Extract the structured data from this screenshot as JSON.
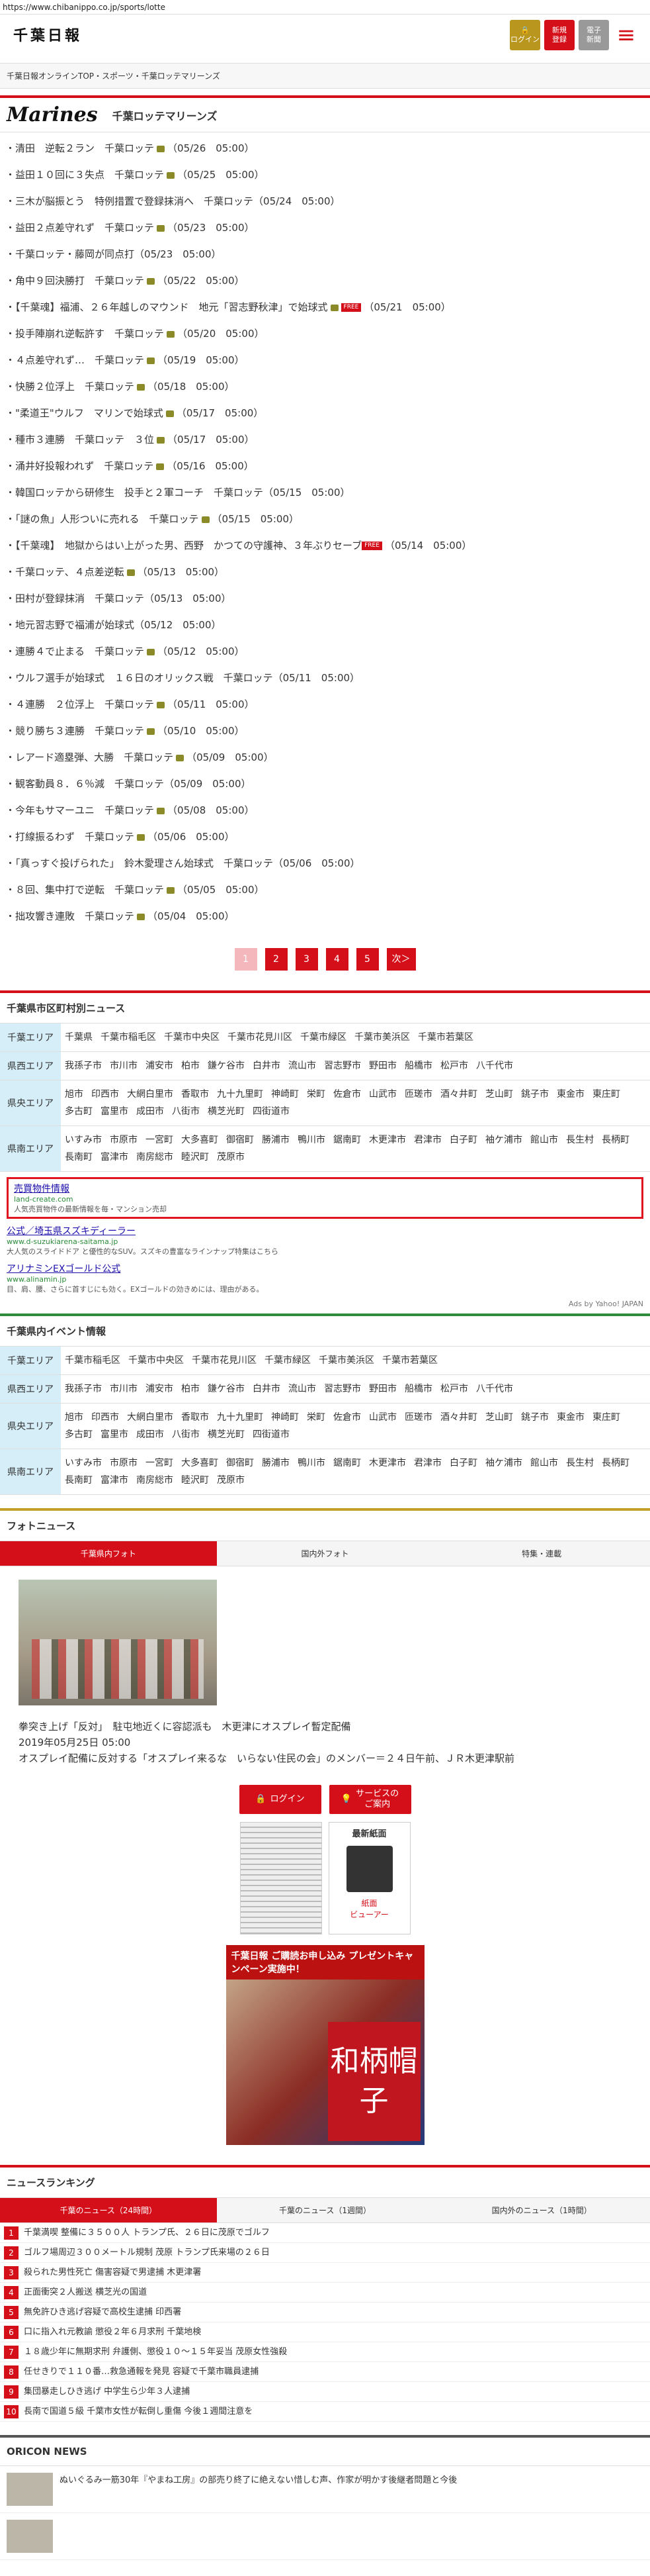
{
  "url": "https://www.chibanippo.co.jp/sports/lotte",
  "header": {
    "logo": "千葉日報",
    "login": "ログイン",
    "register": "新規\n登録",
    "paper": "電子\n新聞",
    "menu": "≡"
  },
  "breadcrumb": "千葉日報オンラインTOP・スポーツ・千葉ロッテマリーンズ",
  "team": {
    "logo": "Marines",
    "title": "千葉ロッテマリーンズ"
  },
  "news": [
    {
      "t": "清田　逆転２ラン　千葉ロッテ",
      "d": "（05/26　05:00）",
      "cam": true
    },
    {
      "t": "益田１０回に３失点　千葉ロッテ",
      "d": "（05/25　05:00）",
      "cam": true
    },
    {
      "t": "三木が脳振とう　特例措置で登録抹消へ　千葉ロッテ",
      "d": "（05/24　05:00）",
      "cam": false
    },
    {
      "t": "益田２点差守れず　千葉ロッテ",
      "d": "（05/23　05:00）",
      "cam": true
    },
    {
      "t": "千葉ロッテ・藤岡が同点打",
      "d": "（05/23　05:00）",
      "cam": false
    },
    {
      "t": "角中９回決勝打　千葉ロッテ",
      "d": "（05/22　05:00）",
      "cam": true
    },
    {
      "t": "【千葉魂】福浦、２６年越しのマウンド　地元「習志野秋津」で始球式",
      "d": "（05/21　05:00）",
      "cam": true,
      "free": true
    },
    {
      "t": "投手陣崩れ逆転許す　千葉ロッテ",
      "d": "（05/20　05:00）",
      "cam": true
    },
    {
      "t": "４点差守れず…　千葉ロッテ",
      "d": "（05/19　05:00）",
      "cam": true
    },
    {
      "t": "快勝２位浮上　千葉ロッテ",
      "d": "（05/18　05:00）",
      "cam": true
    },
    {
      "t": "\"柔道王\"ウルフ　マリンで始球式",
      "d": "（05/17　05:00）",
      "cam": true
    },
    {
      "t": "種市３連勝　千葉ロッテ　３位",
      "d": "（05/17　05:00）",
      "cam": true
    },
    {
      "t": "涌井好投報われず　千葉ロッテ",
      "d": "（05/16　05:00）",
      "cam": true
    },
    {
      "t": "韓国ロッテから研修生　投手と２軍コーチ　千葉ロッテ",
      "d": "（05/15　05:00）",
      "cam": false
    },
    {
      "t": "「謎の魚」人形ついに売れる　千葉ロッテ",
      "d": "（05/15　05:00）",
      "cam": true
    },
    {
      "t": "【千葉魂】　地獄からはい上がった男、西野　かつての守護神、３年ぶりセーブ",
      "d": "（05/14　05:00）",
      "cam": false,
      "free": true
    },
    {
      "t": "千葉ロッテ、４点差逆転",
      "d": "（05/13　05:00）",
      "cam": true
    },
    {
      "t": "田村が登録抹消　千葉ロッテ",
      "d": "（05/13　05:00）",
      "cam": false
    },
    {
      "t": "地元習志野で福浦が始球式",
      "d": "（05/12　05:00）",
      "cam": false
    },
    {
      "t": "連勝４で止まる　千葉ロッテ",
      "d": "（05/12　05:00）",
      "cam": true
    },
    {
      "t": "ウルフ選手が始球式　１６日のオリックス戦　千葉ロッテ",
      "d": "（05/11　05:00）",
      "cam": false
    },
    {
      "t": "４連勝　２位浮上　千葉ロッテ",
      "d": "（05/11　05:00）",
      "cam": true
    },
    {
      "t": "競り勝ち３連勝　千葉ロッテ",
      "d": "（05/10　05:00）",
      "cam": true
    },
    {
      "t": "レアード適塁弾、大勝　千葉ロッテ",
      "d": "（05/09　05:00）",
      "cam": true
    },
    {
      "t": "観客動員８．６％減　千葉ロッテ",
      "d": "（05/09　05:00）",
      "cam": false
    },
    {
      "t": "今年もサマーユニ　千葉ロッテ",
      "d": "（05/08　05:00）",
      "cam": true
    },
    {
      "t": "打線振るわず　千葉ロッテ",
      "d": "（05/06　05:00）",
      "cam": true
    },
    {
      "t": "「真っすぐ投げられた」　鈴木愛理さん始球式　千葉ロッテ",
      "d": "（05/06　05:00）",
      "cam": false
    },
    {
      "t": "８回、集中打で逆転　千葉ロッテ",
      "d": "（05/05　05:00）",
      "cam": true
    },
    {
      "t": "拙攻響き連敗　千葉ロッテ",
      "d": "（05/04　05:00）",
      "cam": true
    }
  ],
  "pager": [
    "1",
    "2",
    "3",
    "4",
    "5",
    "次＞"
  ],
  "city_news": {
    "title": "千葉県市区町村別ニュース",
    "rows": [
      {
        "label": "千葉エリア",
        "items": [
          "千葉県",
          "千葉市稲毛区",
          "千葉市中央区",
          "千葉市花見川区",
          "千葉市緑区",
          "千葉市美浜区",
          "千葉市若葉区"
        ]
      },
      {
        "label": "県西エリア",
        "items": [
          "我孫子市",
          "市川市",
          "浦安市",
          "柏市",
          "鎌ケ谷市",
          "白井市",
          "流山市",
          "習志野市",
          "野田市",
          "船橋市",
          "松戸市",
          "八千代市"
        ]
      },
      {
        "label": "県央エリア",
        "items": [
          "旭市",
          "印西市",
          "大網白里市",
          "香取市",
          "九十九里町",
          "神崎町",
          "栄町",
          "佐倉市",
          "山武市",
          "匝瑳市",
          "酒々井町",
          "芝山町",
          "銚子市",
          "東金市",
          "東庄町",
          "多古町",
          "富里市",
          "成田市",
          "八街市",
          "横芝光町",
          "四街道市"
        ]
      },
      {
        "label": "県南エリア",
        "items": [
          "いすみ市",
          "市原市",
          "一宮町",
          "大多喜町",
          "御宿町",
          "勝浦市",
          "鴨川市",
          "鋸南町",
          "木更津市",
          "君津市",
          "白子町",
          "袖ケ浦市",
          "館山市",
          "長生村",
          "長柄町",
          "長南町",
          "富津市",
          "南房総市",
          "睦沢町",
          "茂原市"
        ]
      }
    ]
  },
  "ads": [
    {
      "title": "売買物件情報",
      "url": "land-create.com",
      "desc": "人気売買物件の最新情報を毎・マンション売却",
      "boxed": true
    },
    {
      "title": "公式／埼玉県スズキディーラー",
      "url": "www.d-suzukiarena-saitama.jp",
      "desc": "大人気のスライドドア と優性的なSUV。スズキの豊富なラインナップ特集はこちら",
      "boxed": false
    },
    {
      "title": "アリナミンEXゴールド公式",
      "url": "www.alinamin.jp",
      "desc": "目、肩、腰、さらに首すじにも効く。EXゴールドの効きめには、理由がある。",
      "boxed": false
    }
  ],
  "ads_source": "Ads by Yahoo! JAPAN",
  "event_info": {
    "title": "千葉県内イベント情報",
    "rows": [
      {
        "label": "千葉エリア",
        "items": [
          "千葉市稲毛区",
          "千葉市中央区",
          "千葉市花見川区",
          "千葉市緑区",
          "千葉市美浜区",
          "千葉市若葉区"
        ]
      },
      {
        "label": "県西エリア",
        "items": [
          "我孫子市",
          "市川市",
          "浦安市",
          "柏市",
          "鎌ケ谷市",
          "白井市",
          "流山市",
          "習志野市",
          "野田市",
          "船橋市",
          "松戸市",
          "八千代市"
        ]
      },
      {
        "label": "県央エリア",
        "items": [
          "旭市",
          "印西市",
          "大網白里市",
          "香取市",
          "九十九里町",
          "神崎町",
          "栄町",
          "佐倉市",
          "山武市",
          "匝瑳市",
          "酒々井町",
          "芝山町",
          "銚子市",
          "東金市",
          "東庄町",
          "多古町",
          "富里市",
          "成田市",
          "八街市",
          "横芝光町",
          "四街道市"
        ]
      },
      {
        "label": "県南エリア",
        "items": [
          "いすみ市",
          "市原市",
          "一宮町",
          "大多喜町",
          "御宿町",
          "勝浦市",
          "鴨川市",
          "鋸南町",
          "木更津市",
          "君津市",
          "白子町",
          "袖ケ浦市",
          "館山市",
          "長生村",
          "長柄町",
          "長南町",
          "富津市",
          "南房総市",
          "睦沢町",
          "茂原市"
        ]
      }
    ]
  },
  "photo_news": {
    "title": "フォトニュース",
    "tabs": [
      "千葉県内フォト",
      "国内外フォト",
      "特集・連載"
    ],
    "caption_title": "拳突き上げ「反対」　駐屯地近くに容認派も　木更津にオスプレイ暫定配備",
    "caption_date": "2019年05月25日 05:00",
    "caption_text": "オスプレイ配備に反対する「オスプレイ来るな　いらない住民の会」のメンバー＝２４日午前、ＪＲ木更津駅前"
  },
  "buttons": {
    "login": "ログイン",
    "service": "サービスの\nご案内"
  },
  "epaper": {
    "head": "最新紙面",
    "label": "紙面\nビューアー"
  },
  "campaign": {
    "caption": "千葉日報 ご購読お申し込み プレゼントキャンペーン実施中！",
    "big": "和柄帽子"
  },
  "ranking": {
    "title": "ニュースランキング",
    "tabs": [
      "千葉のニュース（24時間）",
      "千葉のニュース（1週間）",
      "国内外のニュース（1時間）"
    ],
    "items": [
      "千葉満喫 整備に３５００人 トランプ氏、２６日に茂原でゴルフ",
      "ゴルフ場周辺３００メートル規制 茂原 トランプ氏来場の２６日",
      "殺られた男性死亡 傷害容疑で男逮捕 木更津署",
      "正面衝突２人搬送 横芝光の国道",
      "無免許ひき逃げ容疑で高校生逮捕 印西署",
      "口に指入れ元教諭 懲役２年６月求刑 千葉地検",
      "１８歳少年に無期求刑 弁護側、懲役１０～１５年妥当 茂原女性強殺",
      "任せきりで１１０番…救急通報を発見 容疑で千葉市職員逮捕",
      "集団暴走しひき逃げ 中学生ら少年３人逮捕",
      "長南で国道５級 千葉市女性が転倒し重傷 今後１週間注意を"
    ]
  },
  "oricon": {
    "title": "ORICON NEWS",
    "item": "ぬいぐるみ一筋30年『やまね工房』の部売り終了に絶えない惜しむ声、作家が明かす後継者問題と今後"
  }
}
